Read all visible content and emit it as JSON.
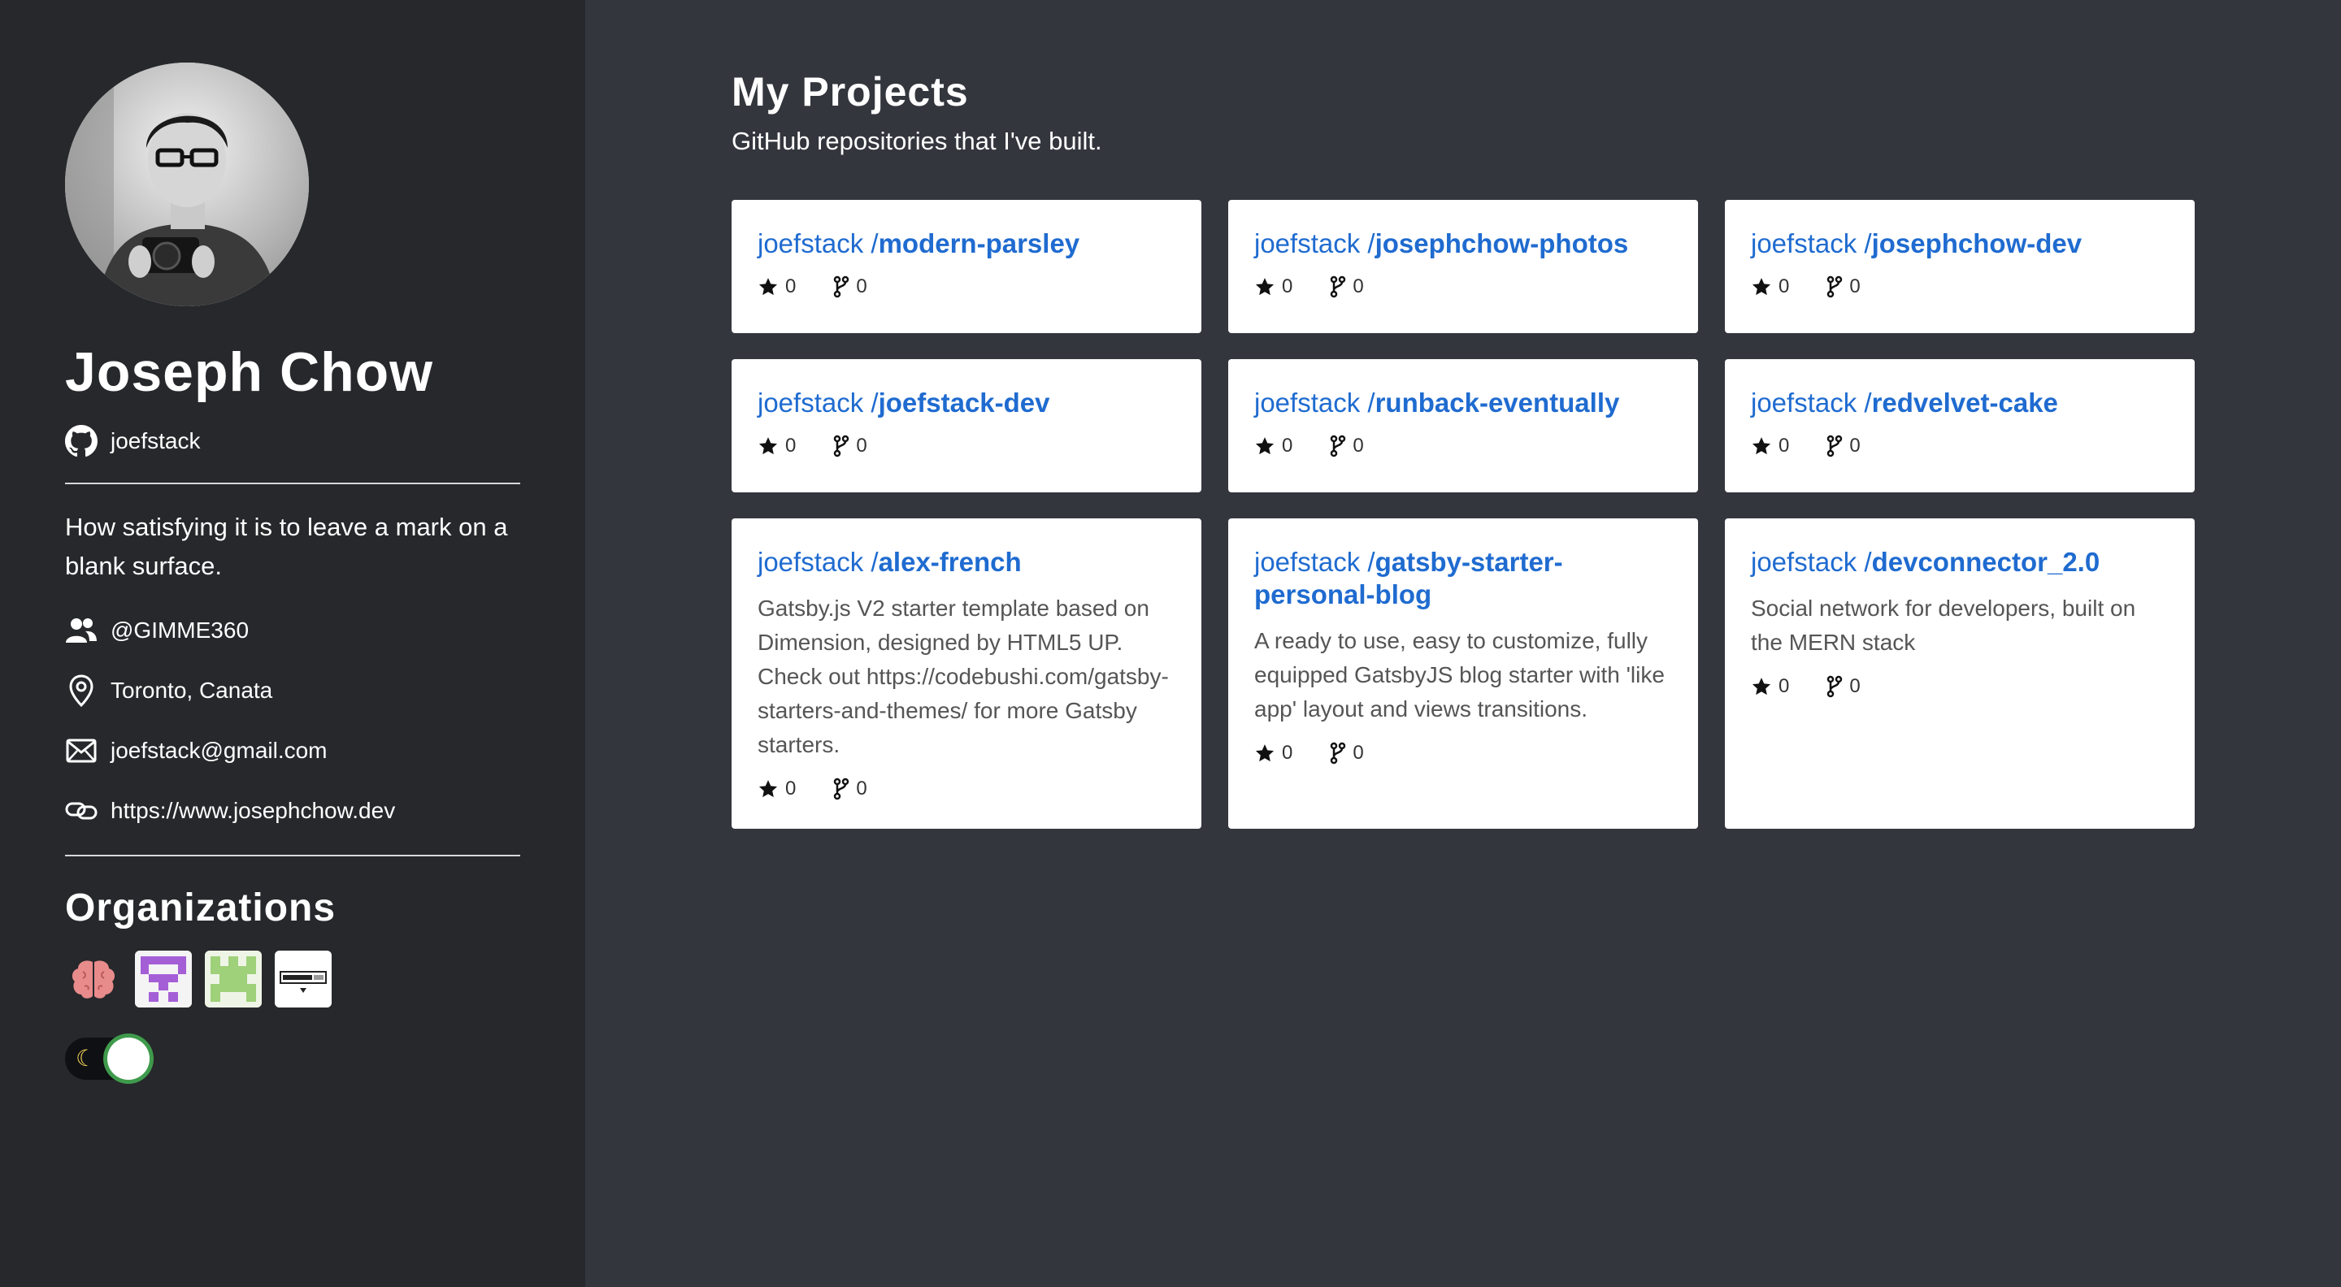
{
  "profile": {
    "name": "Joseph Chow",
    "github_username": "joefstack",
    "bio": "How satisfying it is to leave a mark on a blank surface.",
    "company": "@GIMME360",
    "location": "Toronto, Canata",
    "email": "joefstack@gmail.com",
    "website": "https://www.josephchow.dev"
  },
  "organizations": {
    "title": "Organizations",
    "items": [
      {
        "icon": "brain-icon"
      },
      {
        "icon": "purple-pixel-logo"
      },
      {
        "icon": "green-pixel-logo"
      },
      {
        "icon": "gimme360-logo"
      }
    ]
  },
  "theme_toggle": {
    "icon": "moon-icon",
    "state": "dark"
  },
  "main": {
    "title": "My Projects",
    "subtitle": "GitHub repositories that I've built."
  },
  "repos": [
    {
      "owner": "joefstack /",
      "name": "modern-parsley",
      "description": "",
      "stars": "0",
      "forks": "0"
    },
    {
      "owner": "joefstack /",
      "name": "josephchow-photos",
      "description": "",
      "stars": "0",
      "forks": "0"
    },
    {
      "owner": "joefstack /",
      "name": "josephchow-dev",
      "description": "",
      "stars": "0",
      "forks": "0"
    },
    {
      "owner": "joefstack /",
      "name": "joefstack-dev",
      "description": "",
      "stars": "0",
      "forks": "0"
    },
    {
      "owner": "joefstack /",
      "name": "runback-eventually",
      "description": "",
      "stars": "0",
      "forks": "0"
    },
    {
      "owner": "joefstack /",
      "name": "redvelvet-cake",
      "description": "",
      "stars": "0",
      "forks": "0"
    },
    {
      "owner": "joefstack /",
      "name": "alex-french",
      "description": "Gatsby.js V2 starter template based on Dimension, designed by HTML5 UP. Check out https://codebushi.com/gatsby-starters-and-themes/ for more Gatsby starters.",
      "stars": "0",
      "forks": "0"
    },
    {
      "owner": "joefstack /",
      "name": "gatsby-starter-personal-blog",
      "description": "A ready to use, easy to customize, fully equipped GatsbyJS blog starter with 'like app' layout and views transitions.",
      "stars": "0",
      "forks": "0"
    },
    {
      "owner": "joefstack /",
      "name": "devconnector_2.0",
      "description": "Social network for developers, built on the MERN stack",
      "stars": "0",
      "forks": "0"
    }
  ],
  "colors": {
    "sidebar_bg": "#26282b",
    "main_bg": "#33363d",
    "link": "#1f6bd0",
    "toggle_ring": "#3f9a4c"
  }
}
